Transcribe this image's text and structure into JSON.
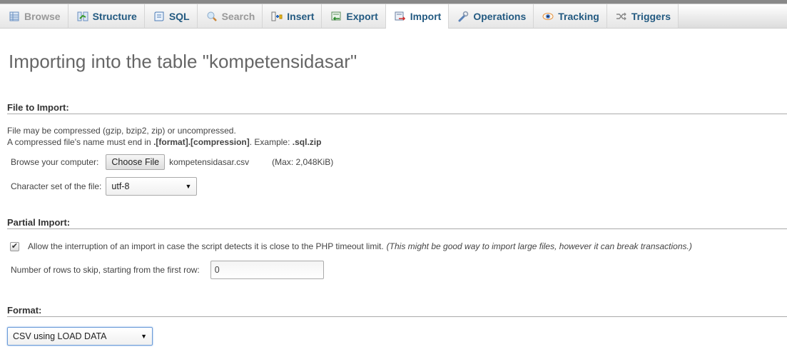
{
  "tabs": [
    {
      "label": "Browse",
      "icon": "browse-table-icon",
      "state": "disabled"
    },
    {
      "label": "Structure",
      "icon": "structure-icon",
      "state": "normal"
    },
    {
      "label": "SQL",
      "icon": "sql-scroll-icon",
      "state": "normal"
    },
    {
      "label": "Search",
      "icon": "search-magnifier-icon",
      "state": "disabled"
    },
    {
      "label": "Insert",
      "icon": "insert-row-icon",
      "state": "normal"
    },
    {
      "label": "Export",
      "icon": "export-icon",
      "state": "normal"
    },
    {
      "label": "Import",
      "icon": "import-icon",
      "state": "active"
    },
    {
      "label": "Operations",
      "icon": "wrench-icon",
      "state": "normal"
    },
    {
      "label": "Tracking",
      "icon": "eye-icon",
      "state": "normal"
    },
    {
      "label": "Triggers",
      "icon": "triggers-icon",
      "state": "normal"
    }
  ],
  "page_title": "Importing into the table \"kompetensidasar\"",
  "file_to_import": {
    "legend": "File to Import:",
    "note_line1": "File may be compressed (gzip, bzip2, zip) or uncompressed.",
    "note_line2_prefix": "A compressed file's name must end in ",
    "note_line2_bold": ".[format].[compression]",
    "note_line2_mid": ". Example: ",
    "note_line2_example": ".sql.zip",
    "browse_label": "Browse your computer:",
    "choose_file_button": "Choose File",
    "chosen_file": "kompetensidasar.csv",
    "max_size": "(Max: 2,048KiB)",
    "charset_label": "Character set of the file:",
    "charset_value": "utf-8"
  },
  "partial_import": {
    "legend": "Partial Import:",
    "allow_interrupt_checked": true,
    "allow_interrupt_label": "Allow the interruption of an import in case the script detects it is close to the PHP timeout limit.",
    "allow_interrupt_hint": "(This might be good way to import large files, however it can break transactions.)",
    "skip_rows_label": "Number of rows to skip, starting from the first row:",
    "skip_rows_value": "0"
  },
  "format": {
    "legend": "Format:",
    "selected": "CSV using LOAD DATA"
  },
  "colors": {
    "tab_text": "#235a81",
    "tab_disabled_text": "#999999",
    "title_text": "#666666"
  }
}
